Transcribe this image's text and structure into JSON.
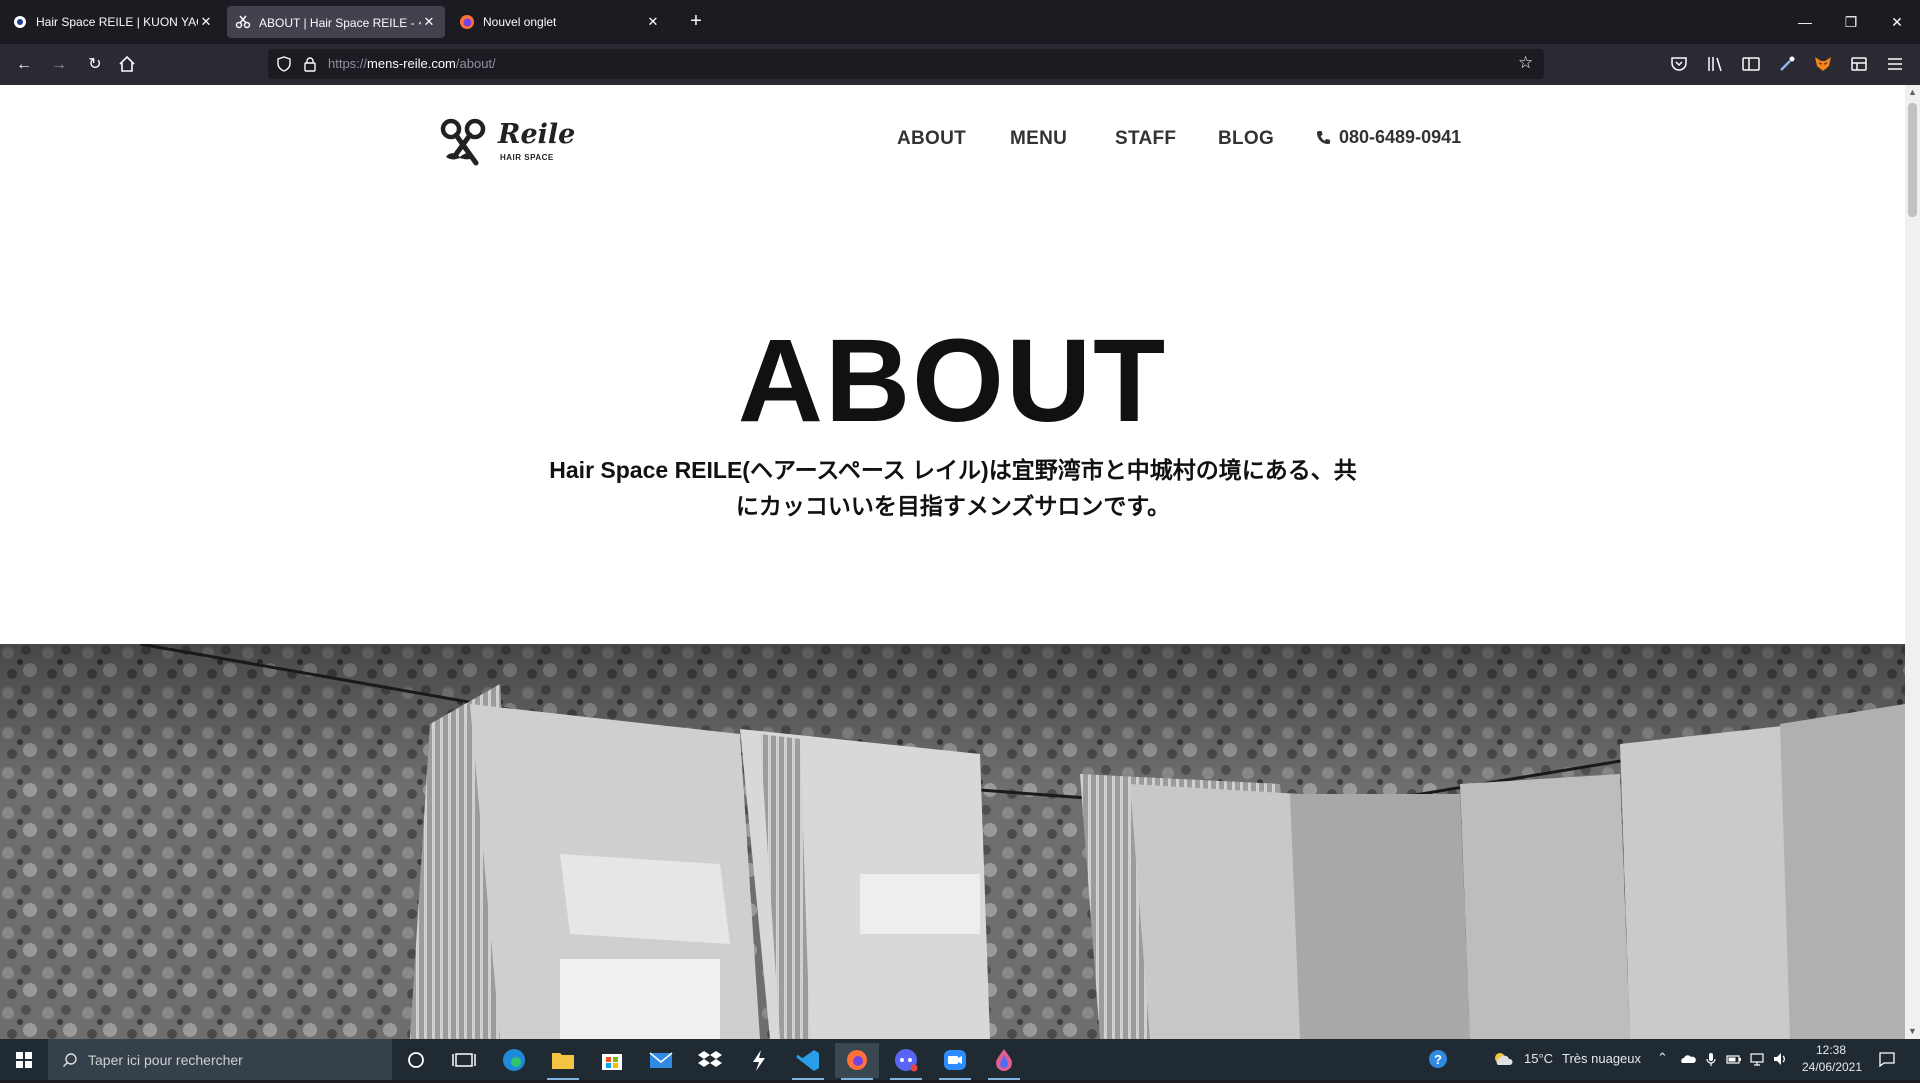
{
  "browser": {
    "tabs": [
      {
        "title": "Hair Space REILE | KUON YAGI P",
        "active": false
      },
      {
        "title": "ABOUT | Hair Space REILE - ヘア",
        "active": true
      },
      {
        "title": "Nouvel onglet",
        "active": false
      }
    ],
    "url_scheme": "https://",
    "url_host": "mens-reile.com",
    "url_path": "/about/"
  },
  "site": {
    "logo_text": "Reile",
    "logo_sub": "HAIR SPACE",
    "nav": [
      "ABOUT",
      "MENU",
      "STAFF",
      "BLOG"
    ],
    "phone": "080-6489-0941",
    "hero_title": "ABOUT",
    "hero_subtitle_line1": "Hair Space REILE(ヘアースペース レイル)は宜野湾市と中城村の境にある、共",
    "hero_subtitle_line2": "にカッコいいを目指すメンズサロンです。"
  },
  "taskbar": {
    "search_placeholder": "Taper ici pour rechercher",
    "weather_temp": "15°C",
    "weather_text": "Très nuageux",
    "time": "12:38",
    "date": "24/06/2021"
  },
  "colors": {
    "browser_bg": "#1c1b22",
    "toolbar_bg": "#2b2a33",
    "taskbar_bg": "#1f2a33",
    "page_text": "#111111"
  }
}
